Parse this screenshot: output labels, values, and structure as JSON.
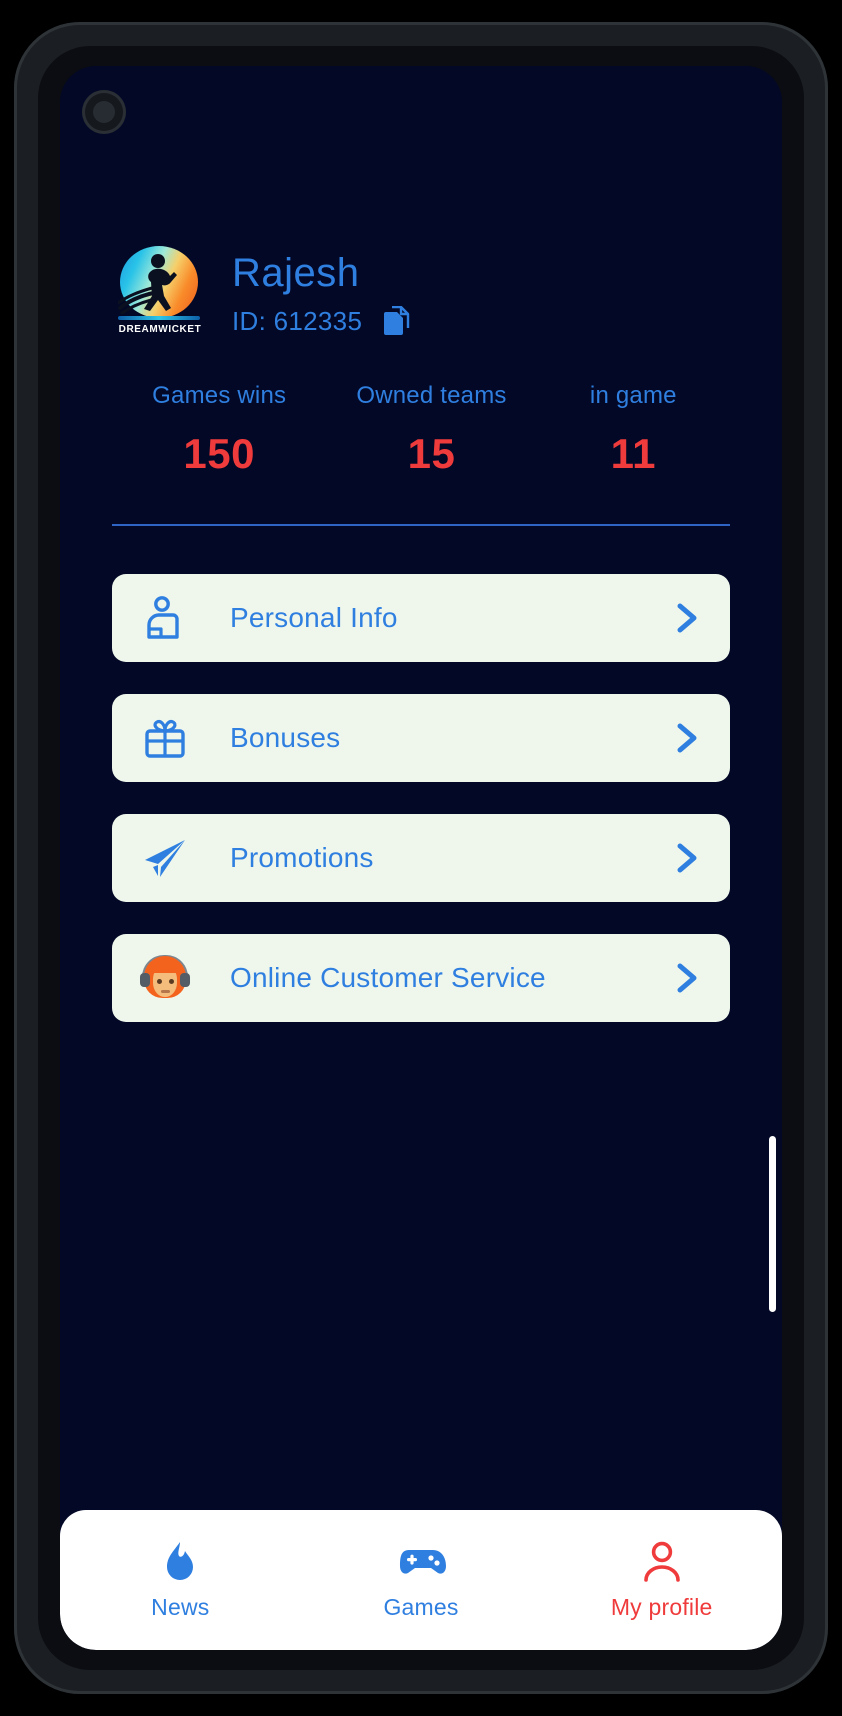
{
  "theme": {
    "screen_bg": "#030826",
    "accent_blue": "#2f7fe0",
    "accent_red": "#ef3b3b",
    "card_bg": "#eff7ec"
  },
  "brand": {
    "logo_icon": "cricket-batsman-logo",
    "logo_text": "DREAMWICKET"
  },
  "profile": {
    "name": "Rajesh",
    "id_label": "ID: 612335",
    "copy_icon": "copy-icon"
  },
  "stats": [
    {
      "label": "Games wins",
      "value": "150"
    },
    {
      "label": "Owned teams",
      "value": "15"
    },
    {
      "label": "in game",
      "value": "11"
    }
  ],
  "menu": [
    {
      "label": "Personal Info",
      "icon": "user-card-icon",
      "chevron": "chevron-right-icon"
    },
    {
      "label": "Bonuses",
      "icon": "gift-icon",
      "chevron": "chevron-right-icon"
    },
    {
      "label": "Promotions",
      "icon": "paper-plane-icon",
      "chevron": "chevron-right-icon"
    },
    {
      "label": "Online Customer Service",
      "icon": "support-agent-icon",
      "chevron": "chevron-right-icon"
    }
  ],
  "bottom_nav": [
    {
      "label": "News",
      "icon": "flame-icon",
      "active": false
    },
    {
      "label": "Games",
      "icon": "gamepad-icon",
      "active": false
    },
    {
      "label": "My profile",
      "icon": "person-icon",
      "active": true
    }
  ]
}
